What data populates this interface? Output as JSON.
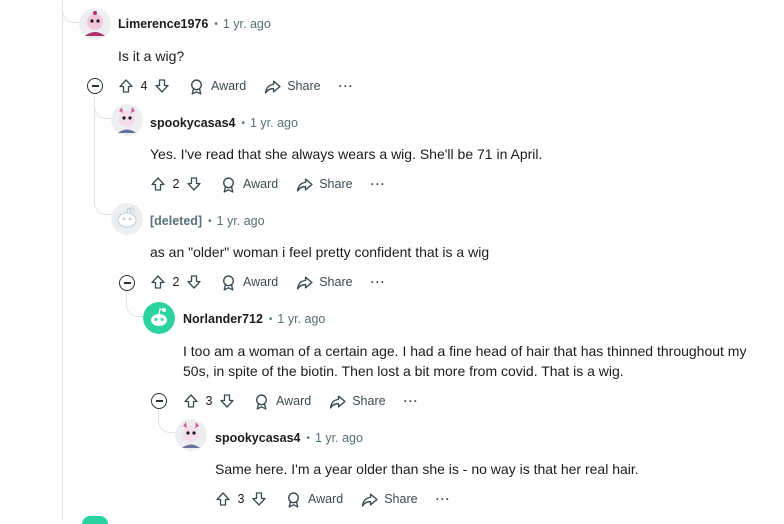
{
  "comments": [
    {
      "author": "Limerence1976",
      "time": "1 yr. ago",
      "body": "Is it a wig?",
      "votes": "4",
      "avatar_icon": "snoo-avatar-pink"
    },
    {
      "author": "spookycasas4",
      "time": "1 yr. ago",
      "body": "Yes. I've read that she always wears a wig. She'll be 71 in April.",
      "votes": "2",
      "avatar_icon": "snoo-avatar-pink"
    },
    {
      "author": "[deleted]",
      "time": "1 yr. ago",
      "body": "as an \"older\" woman i feel pretty confident that is a wig",
      "votes": "2",
      "avatar_icon": "snoo-avatar-grey"
    },
    {
      "author": "Norlander712",
      "time": "1 yr. ago",
      "body_line1": "I too am a woman of a certain age. I had a fine head of hair that has thinned throughout my",
      "body_line2": "50s, in spite of the biotin. Then lost a bit more from covid. That is a wig.",
      "votes": "3",
      "avatar_icon": "snoo-avatar-green"
    },
    {
      "author": "spookycasas4",
      "time": "1 yr. ago",
      "body": "Same here. I'm a year older than she is - no way is that her real hair.",
      "votes": "3",
      "avatar_icon": "snoo-avatar-pink"
    }
  ],
  "actions": {
    "award_label": "Award",
    "share_label": "Share",
    "more_label": "···"
  },
  "colors": {
    "text": "#1c1c1c",
    "meta": "#576f76",
    "thread_line": "#dfe1e3",
    "green_avatar": "#2ad3a0",
    "pink_avatar": "#e9a0c8"
  }
}
